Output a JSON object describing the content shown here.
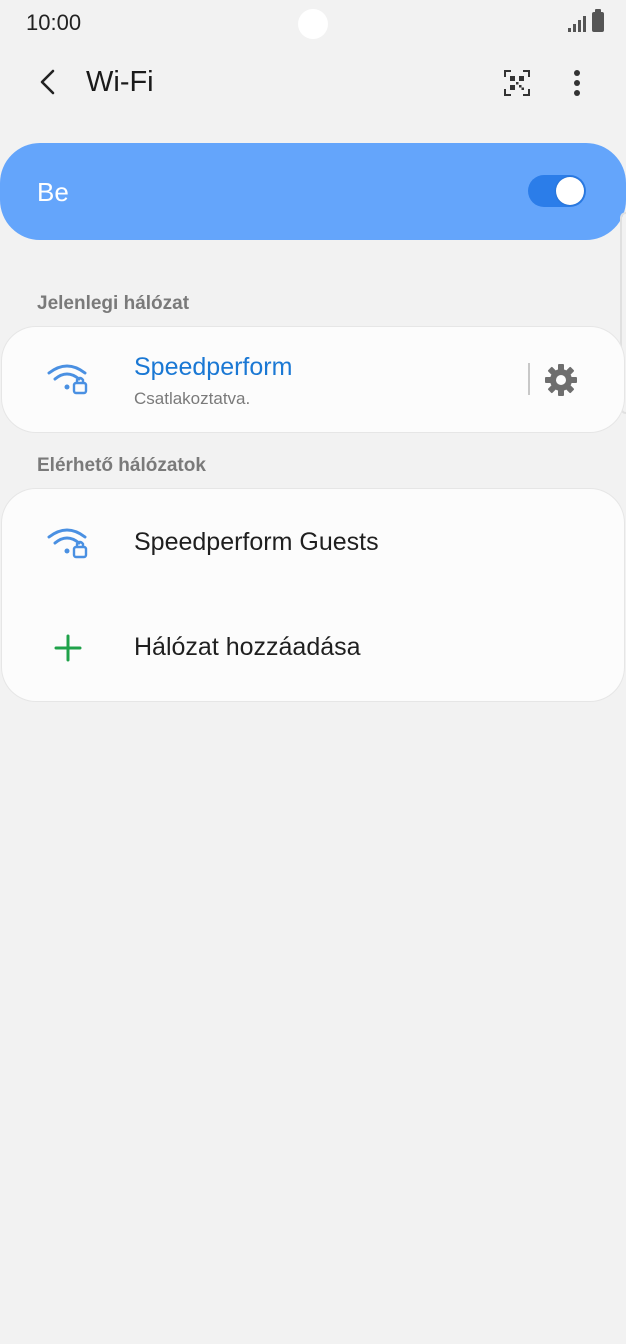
{
  "status_bar": {
    "time": "10:00"
  },
  "app_bar": {
    "title": "Wi-Fi",
    "back_icon": "chevron-left-icon",
    "qr_icon": "qr-code-icon",
    "more_icon": "more-vert-icon"
  },
  "master_toggle": {
    "label": "Be",
    "enabled": true,
    "accent_color": "#64a5fb",
    "switch_color": "#2b7de9"
  },
  "current_network": {
    "header": "Jelenlegi hálózat",
    "name": "Speedperform",
    "status": "Csatlakoztatva.",
    "icon": "wifi-lock-icon",
    "settings_icon": "gear-icon",
    "name_color": "#1a78d4"
  },
  "available_networks": {
    "header": "Elérhető hálózatok",
    "items": [
      {
        "name": "Speedperform Guests",
        "icon": "wifi-lock-icon"
      }
    ],
    "add_network": {
      "label": "Hálózat hozzáadása",
      "icon": "plus-icon",
      "icon_color": "#1fa24a"
    }
  }
}
